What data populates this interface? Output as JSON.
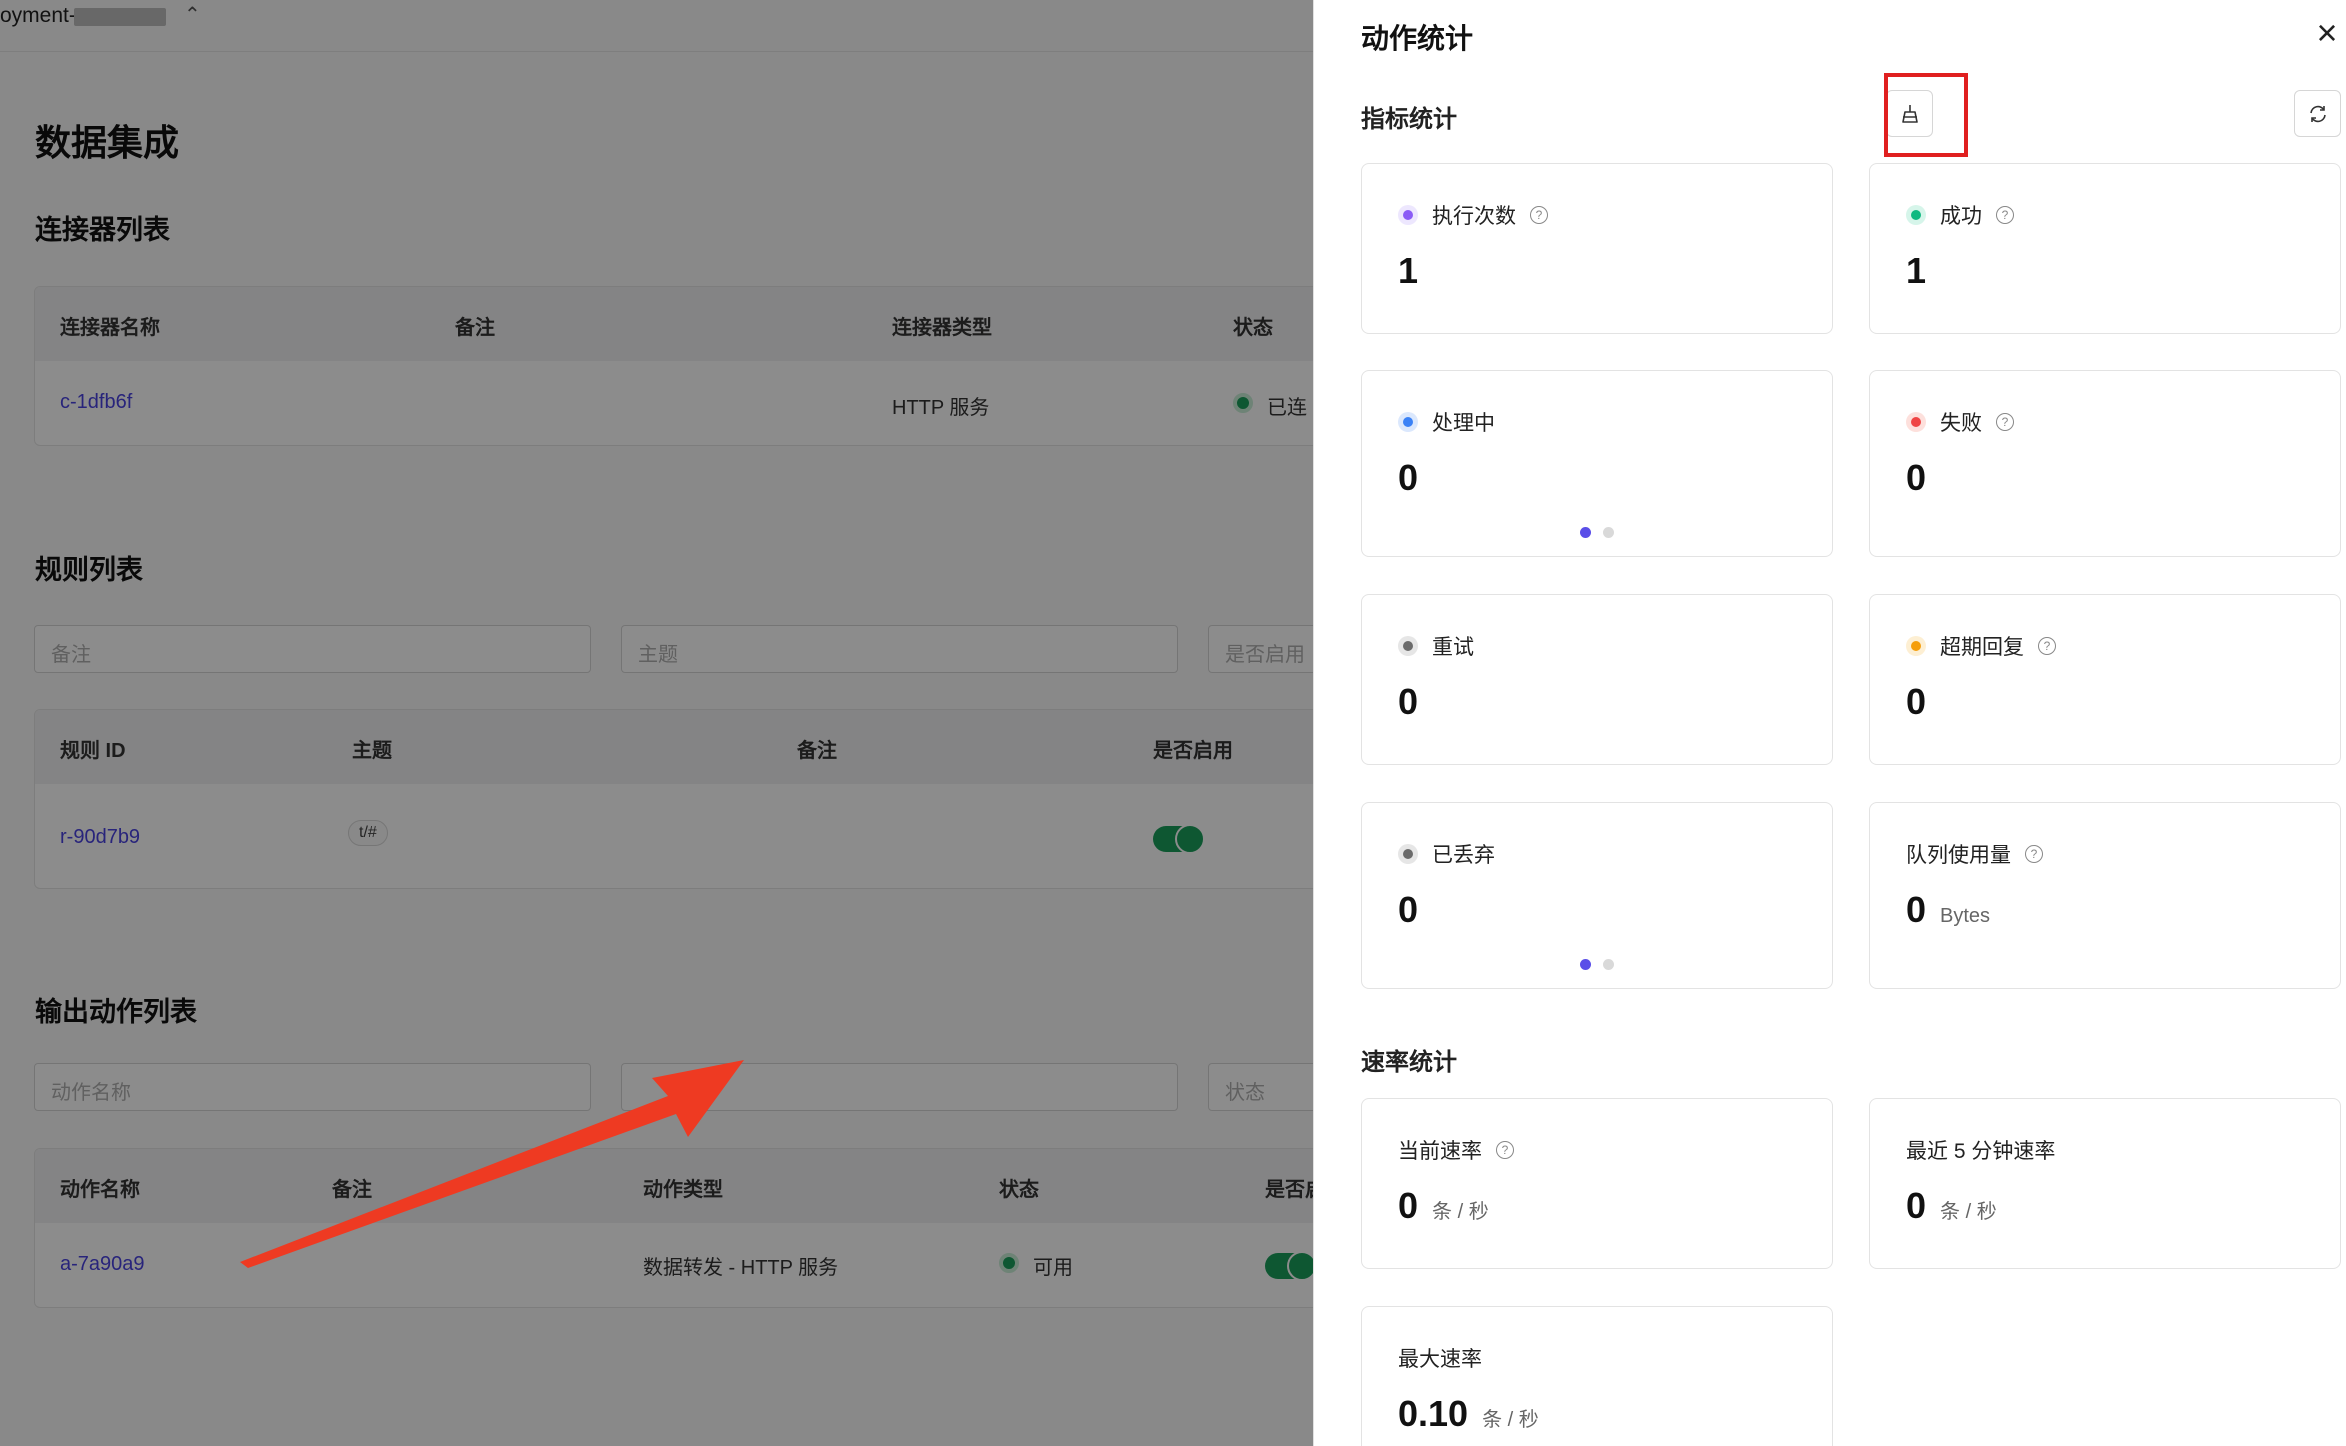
{
  "background": {
    "deployment_label": "oyment-",
    "title": "数据集成",
    "connectors": {
      "heading": "连接器列表",
      "columns": [
        "连接器名称",
        "备注",
        "连接器类型",
        "状态"
      ],
      "row": {
        "name": "c-1dfb6f",
        "type": "HTTP 服务",
        "status": "已连"
      }
    },
    "rules": {
      "heading": "规则列表",
      "filters": [
        "备注",
        "主题",
        "是否启用"
      ],
      "columns": [
        "规则 ID",
        "主题",
        "备注",
        "是否启用"
      ],
      "row": {
        "id": "r-90d7b9",
        "topic": "t/#"
      }
    },
    "actions": {
      "heading": "输出动作列表",
      "filters": [
        "动作名称",
        "状态"
      ],
      "columns": [
        "动作名称",
        "备注",
        "动作类型",
        "状态",
        "是否启"
      ],
      "row": {
        "name": "a-7a90a9",
        "type": "数据转发 - HTTP 服务",
        "status": "可用"
      }
    }
  },
  "drawer": {
    "title": "动作统计",
    "close_icon": "close-icon",
    "metrics_heading": "指标统计",
    "reset_icon": "broom-reset-icon",
    "refresh_icon": "refresh-icon",
    "metrics": [
      {
        "label": "执行次数",
        "value": "1",
        "color": "#8b5cf6",
        "help": true
      },
      {
        "label": "成功",
        "value": "1",
        "color": "#10b981",
        "help": true
      },
      {
        "label": "处理中",
        "value": "0",
        "color": "#3b82f6",
        "help": false,
        "pager": true
      },
      {
        "label": "失败",
        "value": "0",
        "color": "#ef4444",
        "help": true
      },
      {
        "label": "重试",
        "value": "0",
        "color": "#6b6b6b",
        "help": false
      },
      {
        "label": "超期回复",
        "value": "0",
        "color": "#f59e0b",
        "help": true
      },
      {
        "label": "已丢弃",
        "value": "0",
        "color": "#6b6b6b",
        "help": false,
        "pager": true
      },
      {
        "label": "队列使用量",
        "value": "0",
        "unit": "Bytes",
        "help": true
      }
    ],
    "rate_heading": "速率统计",
    "rates": [
      {
        "label": "当前速率",
        "value": "0",
        "unit": "条 / 秒",
        "help": true
      },
      {
        "label": "最近 5 分钟速率",
        "value": "0",
        "unit": "条 / 秒",
        "help": false
      },
      {
        "label": "最大速率",
        "value": "0.10",
        "unit": "条 / 秒",
        "help": false
      }
    ]
  }
}
